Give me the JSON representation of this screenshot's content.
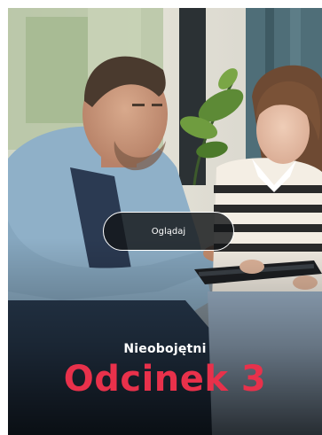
{
  "hero": {
    "play_label": "Oglądaj",
    "series_title": "Nieobojętni",
    "episode_title": "Odcinek 3"
  },
  "colors": {
    "episode_accent": "#e8314b",
    "button_border": "#ffffff"
  }
}
